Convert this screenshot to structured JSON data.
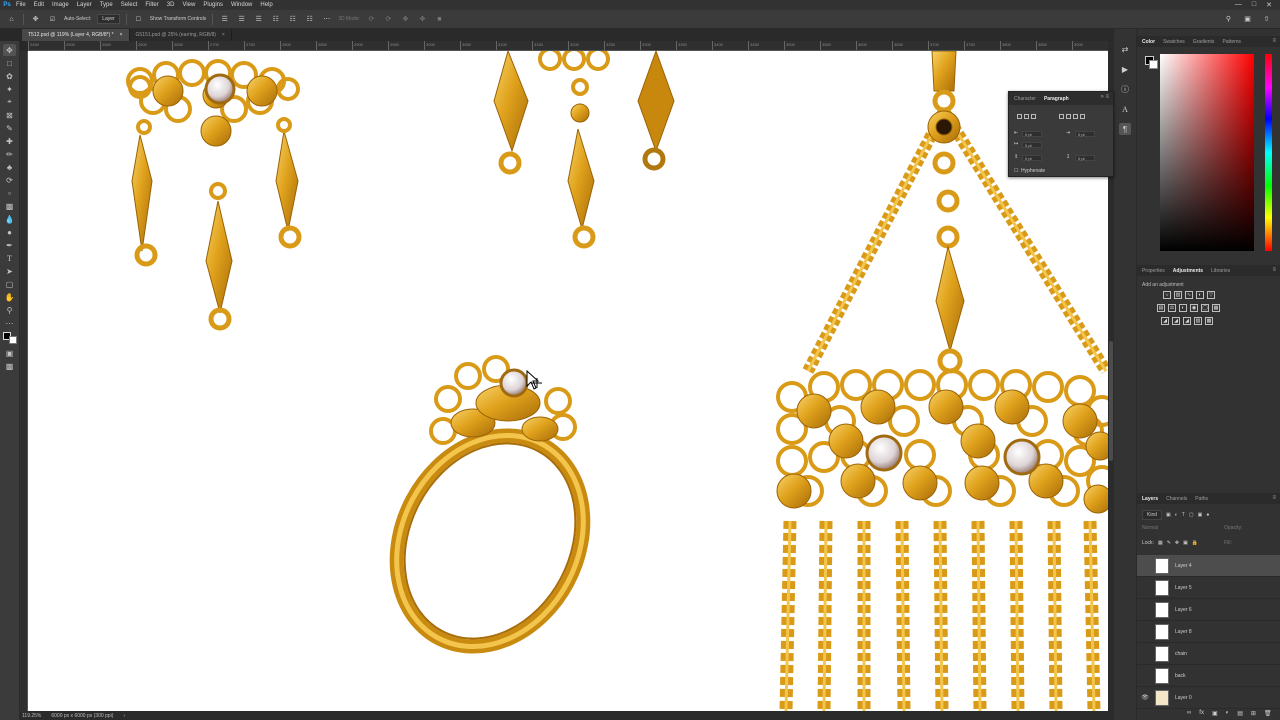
{
  "menubar": {
    "logo": "Ps",
    "items": [
      "File",
      "Edit",
      "Image",
      "Layer",
      "Type",
      "Select",
      "Filter",
      "3D",
      "View",
      "Plugins",
      "Window",
      "Help"
    ]
  },
  "options": {
    "auto_select_label": "Auto-Select:",
    "auto_select_value": "Layer",
    "transform_label": "Show Transform Controls",
    "mode_3d": "3D Mode:"
  },
  "tabs": [
    {
      "label": "T512.psd @ 119% (Layer 4, RGB/8*) *",
      "active": true
    },
    {
      "label": "G5151.psd @ 25% (earring, RGB/8)",
      "active": false
    }
  ],
  "ruler_ticks": [
    "2450",
    "2500",
    "2550",
    "2600",
    "2650",
    "2700",
    "2750",
    "2800",
    "2850",
    "2900",
    "2950",
    "3000",
    "3050",
    "3100",
    "3150",
    "3200",
    "3250",
    "3300",
    "3350",
    "3400",
    "3450",
    "3500",
    "3550",
    "3600",
    "3650",
    "3700",
    "3750",
    "3800",
    "3850",
    "3900"
  ],
  "status": {
    "zoom": "119.25%",
    "doc_info": "6000 px x 6000 px (300 ppi)"
  },
  "color_panel": {
    "tabs": [
      "Color",
      "Swatches",
      "Gradients",
      "Patterns"
    ],
    "active": "Color"
  },
  "adjustments_panel": {
    "tabs": [
      "Properties",
      "Adjustments",
      "Libraries"
    ],
    "active": "Adjustments",
    "hint": "Add an adjustment"
  },
  "layers_panel": {
    "tabs": [
      "Layers",
      "Channels",
      "Paths"
    ],
    "active": "Layers",
    "filter_kind": "Kind",
    "blend_mode": "Normal",
    "opacity_label": "Opacity:",
    "lock_label": "Lock:",
    "fill_label": "Fill:",
    "layers": [
      {
        "name": "Layer 4",
        "selected": true,
        "visible": false
      },
      {
        "name": "Layer 5",
        "selected": false,
        "visible": false
      },
      {
        "name": "Layer 6",
        "selected": false,
        "visible": false
      },
      {
        "name": "Layer 8",
        "selected": false,
        "visible": false
      },
      {
        "name": "chain",
        "selected": false,
        "visible": false
      },
      {
        "name": "back",
        "selected": false,
        "visible": false
      },
      {
        "name": "Layer 0",
        "selected": false,
        "visible": true
      }
    ]
  },
  "paragraph_panel": {
    "tabs": [
      "Character",
      "Paragraph"
    ],
    "active": "Paragraph",
    "indent_left": "0 pt",
    "indent_right": "0 pt",
    "indent_first": "0 pt",
    "space_before": "0 pt",
    "space_after": "0 pt",
    "hyphenate_label": "Hyphenate"
  },
  "colors": {
    "gold": "#e0a21c",
    "gold_dark": "#a86c08",
    "gold_light": "#f6cd5a",
    "ui_bg": "#323232",
    "accent_blue": "#31a8ff"
  }
}
